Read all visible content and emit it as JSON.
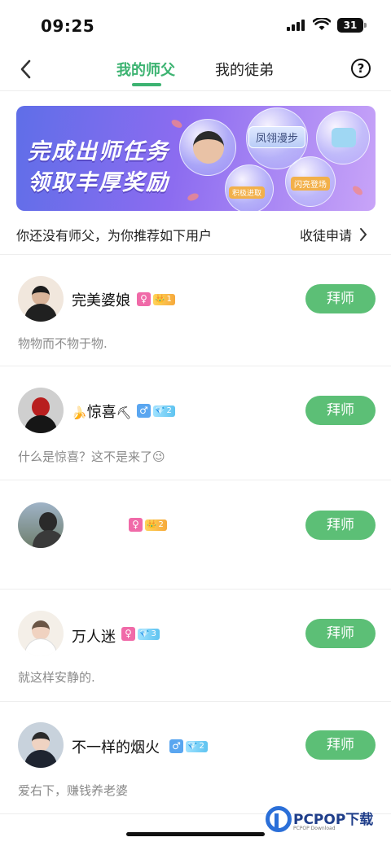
{
  "status_bar": {
    "time": "09:25",
    "battery": "31"
  },
  "nav": {
    "tabs": [
      {
        "label": "我的师父",
        "active": true
      },
      {
        "label": "我的徒弟",
        "active": false
      }
    ],
    "help_glyph": "?"
  },
  "banner": {
    "line1": "完成出师任务",
    "line2": "领取丰厚奖励",
    "bubble_tags": [
      "凤翎漫步",
      "闪亮登场",
      "积极进取"
    ]
  },
  "recommend": {
    "text": "你还没有师父，为你推荐如下用户",
    "apply_label": "收徒申请"
  },
  "users": [
    {
      "nickname": "完美婆娘",
      "prefix_emoji": "",
      "suffix_emoji": "",
      "gender": "female",
      "gender_glyph": "♀",
      "level": "1",
      "level_style": "gold",
      "bio": "物物而不物于物.",
      "button": "拜师"
    },
    {
      "nickname": "惊喜",
      "prefix_emoji": "🍌",
      "suffix_emoji": "⛏",
      "gender": "male",
      "gender_glyph": "♂",
      "level": "2",
      "level_style": "blue",
      "bio": "什么是惊喜？这不是来了😉",
      "button": "拜师"
    },
    {
      "nickname": "",
      "prefix_emoji": "",
      "suffix_emoji": "",
      "gender": "female",
      "gender_glyph": "♀",
      "level": "2",
      "level_style": "gold",
      "bio": "",
      "button": "拜师"
    },
    {
      "nickname": "万人迷",
      "prefix_emoji": "",
      "suffix_emoji": "",
      "gender": "female",
      "gender_glyph": "♀",
      "level": "3",
      "level_style": "blue",
      "bio": "就这样安静的.",
      "button": "拜师"
    },
    {
      "nickname": "不一样的烟火",
      "prefix_emoji": "",
      "suffix_emoji": "",
      "gender": "male",
      "gender_glyph": "♂",
      "level": "2",
      "level_style": "blue",
      "bio": "爱右下，赚钱养老婆",
      "button": "拜师"
    }
  ],
  "watermark": {
    "title": "PCPOP下载",
    "subtitle": "PCPOP Download"
  },
  "colors": {
    "accent": "#3cb371",
    "button": "#5cbf76",
    "female": "#f06aa8",
    "male": "#5aa6f0"
  }
}
